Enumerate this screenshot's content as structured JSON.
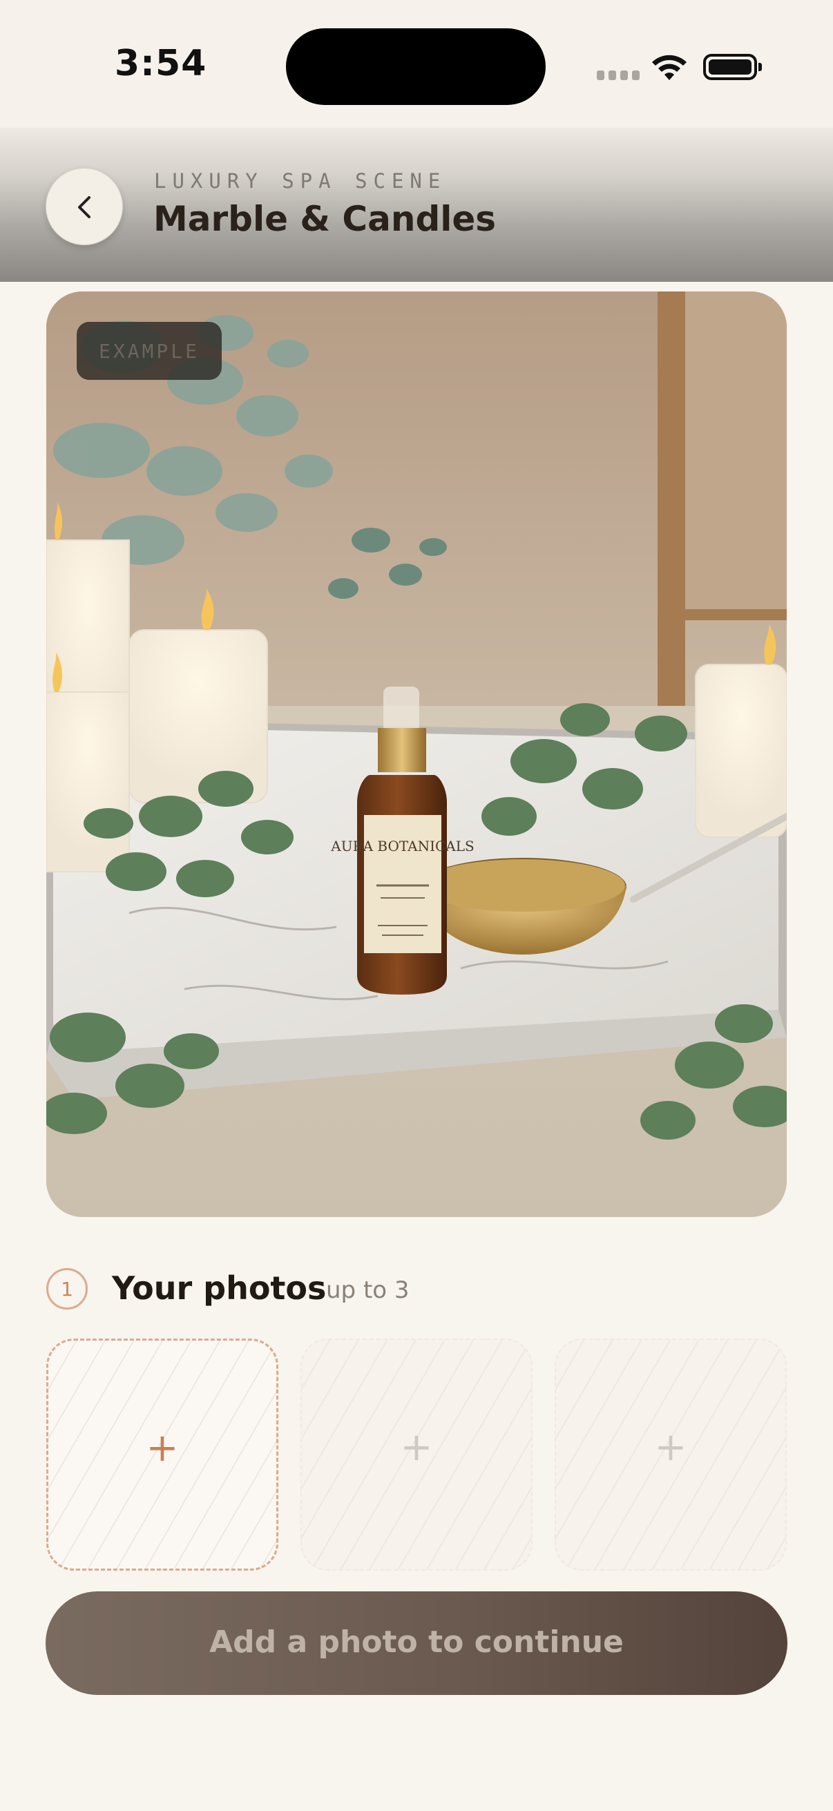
{
  "status_bar": {
    "time": "3:54"
  },
  "header": {
    "eyebrow": "LUXURY SPA SCENE",
    "title": "Marble & Candles",
    "back_icon": "chevron-left-icon"
  },
  "hero": {
    "badge": "EXAMPLE",
    "bottle_label_brand": "AURA BOTANICALS"
  },
  "photos": {
    "step": "1",
    "title": "Your photos",
    "hint": "up to 3",
    "slots": [
      {
        "icon": "+",
        "state": "active"
      },
      {
        "icon": "+",
        "state": "disabled"
      },
      {
        "icon": "+",
        "state": "disabled"
      }
    ]
  },
  "cta": {
    "label": "Add a photo to continue"
  },
  "colors": {
    "accent": "#c97f54",
    "background": "#f8f4ee",
    "cta": "#6a5a4f"
  }
}
